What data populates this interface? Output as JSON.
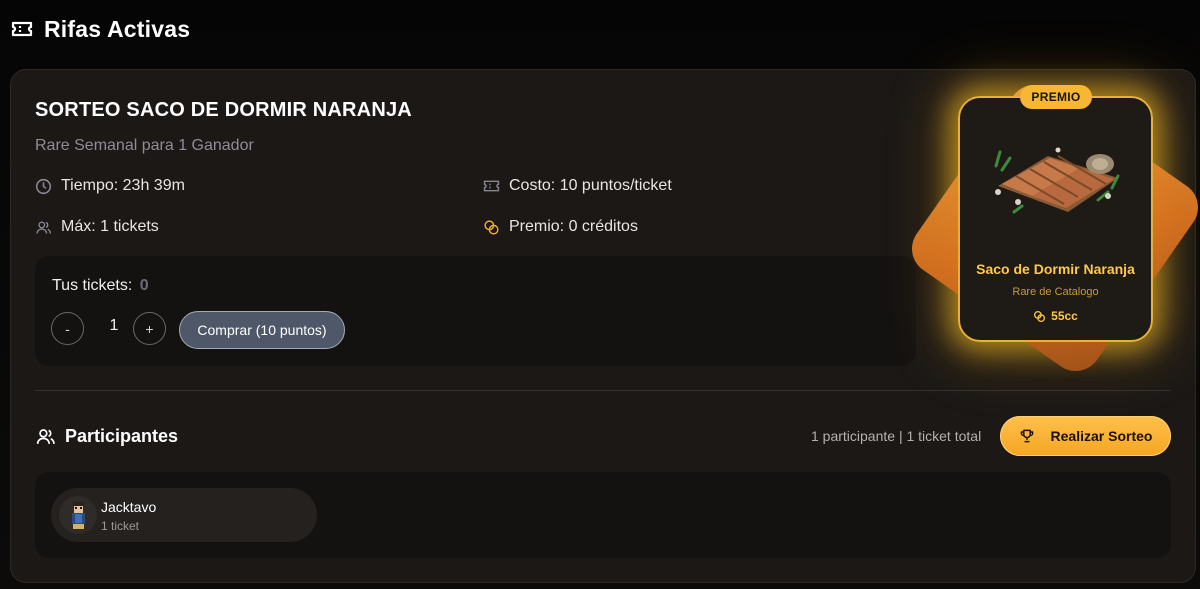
{
  "header": {
    "title": "Rifas Activas",
    "icon": "ticket-icon"
  },
  "raffle": {
    "title": "SORTEO SACO DE DORMIR NARANJA",
    "subtitle": "Rare Semanal para 1 Ganador",
    "time": {
      "label": "Tiempo: 23h 39m",
      "icon": "clock-icon"
    },
    "cost": {
      "label": "Costo: 10 puntos/ticket",
      "icon": "ticket-icon"
    },
    "max": {
      "label": "Máx: 1 tickets",
      "icon": "users-icon"
    },
    "prize_info": {
      "label": "Premio: 0 créditos",
      "icon": "coins-icon"
    },
    "tickets": {
      "label": "Tus tickets:",
      "count": "0",
      "decrement_label": "-",
      "quantity": "1",
      "increment_label": "+",
      "buy_label": "Comprar (10 puntos)"
    }
  },
  "participants": {
    "title": "Participantes",
    "summary": "1 participante | 1 ticket total",
    "draw_button_label": "Realizar Sorteo",
    "list": [
      {
        "name": "Jacktavo",
        "tickets": "1 ticket"
      }
    ]
  },
  "prize_card": {
    "badge": "PREMIO",
    "name": "Saco de Dormir Naranja",
    "type": "Rare de Catalogo",
    "value": "55cc"
  },
  "colors": {
    "accent": "#f7b733",
    "prize_text": "#ffc94a",
    "card_bg": "#1b1816",
    "button_blue": "#4f5869"
  }
}
